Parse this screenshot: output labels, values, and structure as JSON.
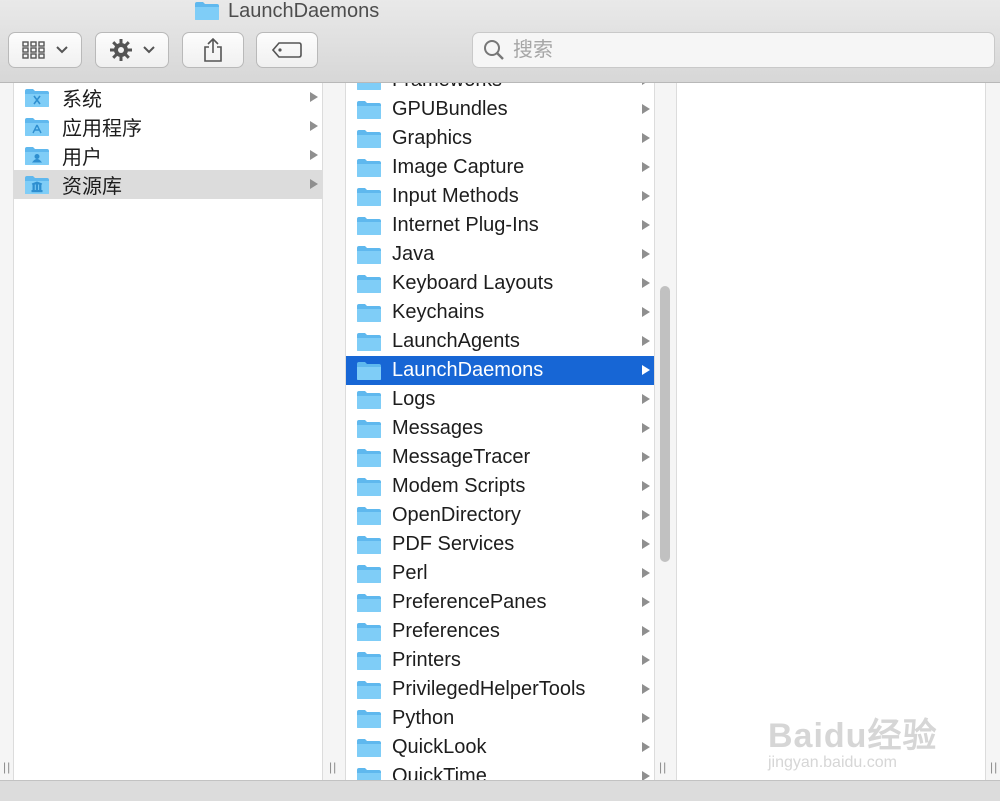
{
  "window": {
    "title": "LaunchDaemons"
  },
  "toolbar": {
    "view_icon": "grid-icon",
    "action_icon": "gear-icon",
    "share_icon": "share-icon",
    "tag_icon": "tag-icon"
  },
  "search": {
    "placeholder": "搜索",
    "value": ""
  },
  "columns": {
    "col1": [
      {
        "label": "系统",
        "icon": "system-folder-icon"
      },
      {
        "label": "应用程序",
        "icon": "applications-folder-icon"
      },
      {
        "label": "用户",
        "icon": "users-folder-icon"
      },
      {
        "label": "资源库",
        "icon": "library-folder-icon",
        "selected": true
      }
    ],
    "col2": [
      {
        "label": "Frameworks"
      },
      {
        "label": "GPUBundles"
      },
      {
        "label": "Graphics"
      },
      {
        "label": "Image Capture"
      },
      {
        "label": "Input Methods"
      },
      {
        "label": "Internet Plug-Ins"
      },
      {
        "label": "Java"
      },
      {
        "label": "Keyboard Layouts"
      },
      {
        "label": "Keychains"
      },
      {
        "label": "LaunchAgents"
      },
      {
        "label": "LaunchDaemons",
        "selected": true
      },
      {
        "label": "Logs"
      },
      {
        "label": "Messages"
      },
      {
        "label": "MessageTracer"
      },
      {
        "label": "Modem Scripts"
      },
      {
        "label": "OpenDirectory"
      },
      {
        "label": "PDF Services"
      },
      {
        "label": "Perl"
      },
      {
        "label": "PreferencePanes"
      },
      {
        "label": "Preferences"
      },
      {
        "label": "Printers"
      },
      {
        "label": "PrivilegedHelperTools"
      },
      {
        "label": "Python"
      },
      {
        "label": "QuickLook"
      },
      {
        "label": "QuickTime"
      }
    ]
  },
  "watermark": {
    "main": "Baidu经验",
    "sub": "jingyan.baidu.com"
  },
  "colors": {
    "selection_blue": "#1766d5",
    "folder_blue": "#6cc3f5"
  }
}
